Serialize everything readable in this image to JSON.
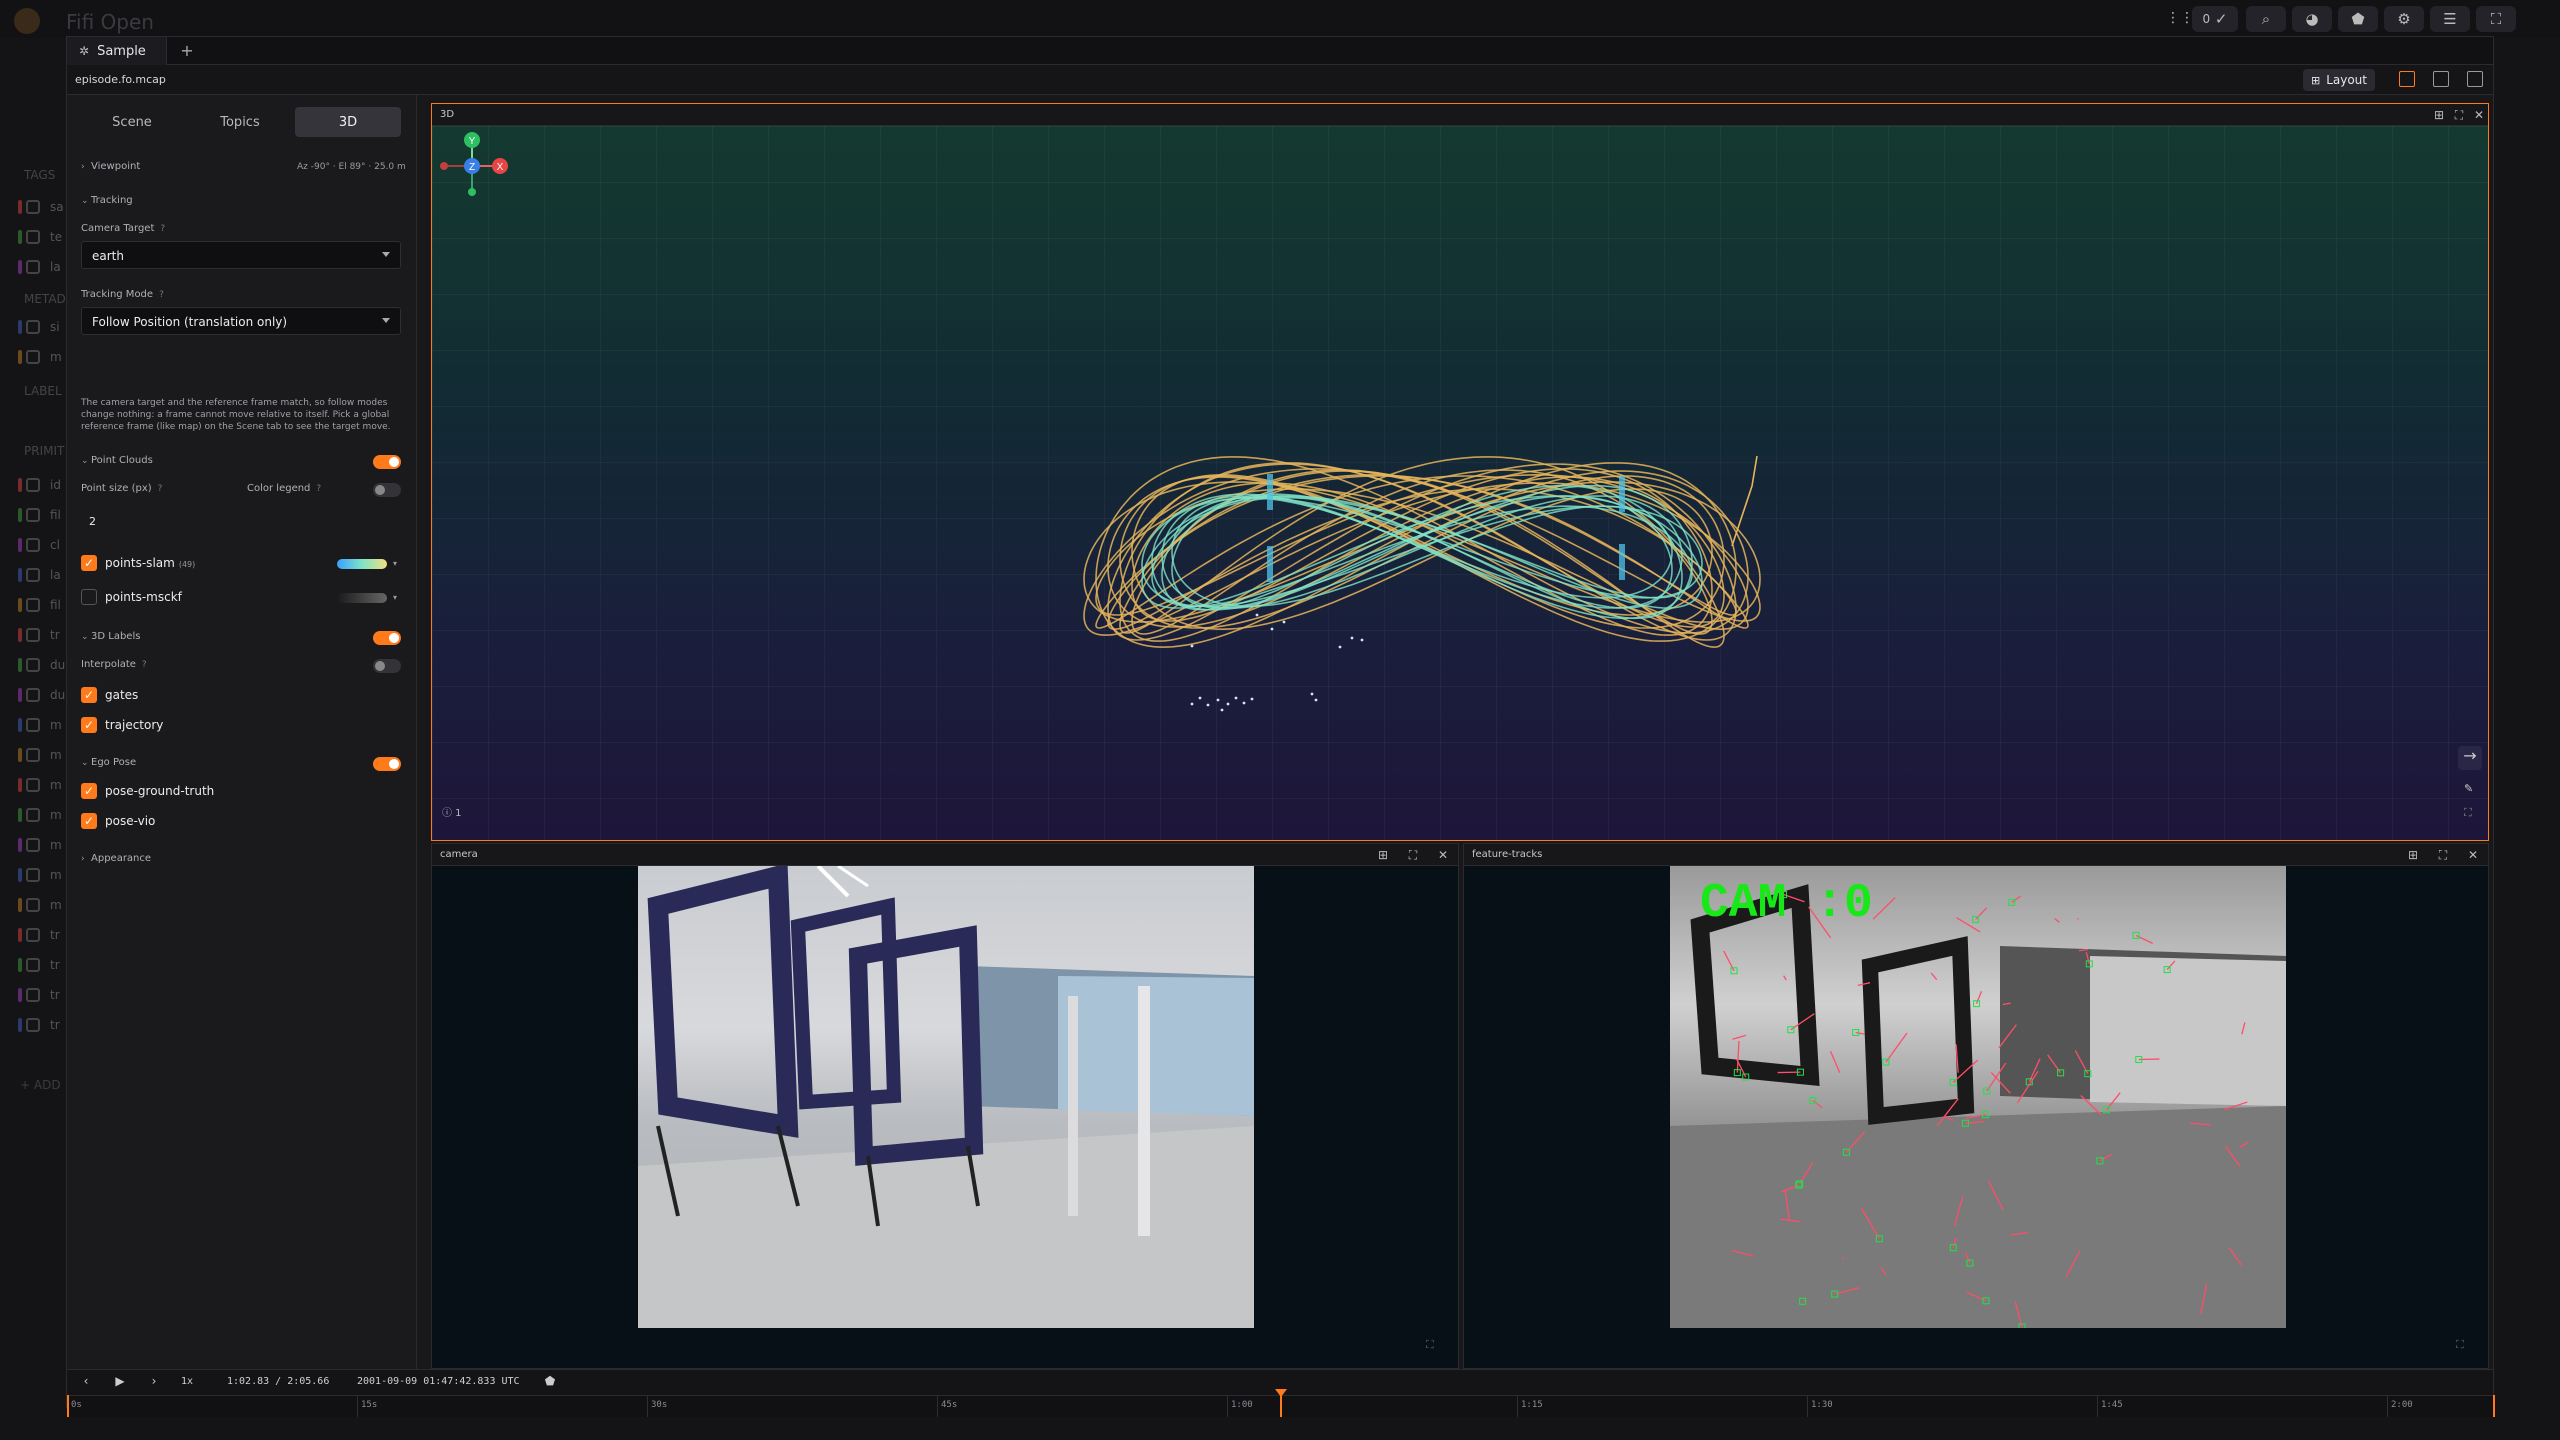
{
  "app": {
    "bg_title": "Fifi Open",
    "top_counter": "0"
  },
  "bg_sidebar": {
    "tags_label": "TAGS",
    "meta_label": "METAD",
    "labels_label": "LABEL",
    "prims_label": "PRIMIT",
    "add_label": "+ ADD",
    "rows": [
      "sa",
      "te",
      "la",
      "si",
      "m",
      "id",
      "fil",
      "cl",
      "la",
      "fil",
      "tr",
      "du",
      "du",
      "m",
      "m",
      "m",
      "m",
      "m",
      "m",
      "m",
      "tr",
      "tr",
      "tr",
      "tr"
    ]
  },
  "tabs": {
    "sample_label": "Sample",
    "add_label": "+"
  },
  "file": {
    "name": "episode.fo.mcap",
    "layout_label": "Layout"
  },
  "sidebar": {
    "tabs": [
      "Scene",
      "Topics",
      "3D"
    ],
    "viewpoint": {
      "label": "Viewpoint",
      "readout": "Az -90° · El 89° · 25.0 m"
    },
    "tracking": {
      "label": "Tracking",
      "camera_target_label": "Camera Target",
      "camera_target_value": "earth",
      "mode_label": "Tracking Mode",
      "mode_value": "Follow Position (translation only)",
      "help": "The camera target and the reference frame match, so follow modes change nothing: a frame cannot move relative to itself. Pick a global reference frame (like map) on the Scene tab to see the target move."
    },
    "point_clouds": {
      "label": "Point Clouds",
      "point_size_label": "Point size (px)",
      "point_size_value": "2",
      "color_legend_label": "Color legend",
      "items": [
        {
          "label": "points-slam",
          "count": "(49)",
          "checked": true
        },
        {
          "label": "points-msckf",
          "count": "",
          "checked": false
        }
      ]
    },
    "labels_3d": {
      "label": "3D Labels",
      "interpolate_label": "Interpolate",
      "items": [
        {
          "label": "gates",
          "checked": true
        },
        {
          "label": "trajectory",
          "checked": true
        }
      ]
    },
    "ego_pose": {
      "label": "Ego Pose",
      "items": [
        {
          "label": "pose-ground-truth",
          "checked": true
        },
        {
          "label": "pose-vio",
          "checked": true
        }
      ]
    },
    "appearance": {
      "label": "Appearance"
    }
  },
  "panels": {
    "p3d": {
      "title": "3D",
      "info_badge": "ⓘ 1"
    },
    "camera": {
      "title": "camera"
    },
    "feature": {
      "title": "feature-tracks",
      "overlay": "CAM :0"
    }
  },
  "axes_gizmo": {
    "y": "Y",
    "z": "Z",
    "x": "X"
  },
  "playback": {
    "speed": "1x",
    "time": "1:02.83 / 2:05.66",
    "datetime": "2001-09-09 01:47:42.833 UTC",
    "progress_fraction": 0.4997,
    "ticks": [
      "0s",
      "15s",
      "30s",
      "45s",
      "1:00",
      "1:15",
      "1:30",
      "1:45",
      "2:00"
    ]
  },
  "colors": {
    "accent": "#ff7a1a",
    "trajectory_gt": "#e6b55a",
    "trajectory_vio": "#7fe3c8",
    "gate": "#4fc3e8"
  }
}
